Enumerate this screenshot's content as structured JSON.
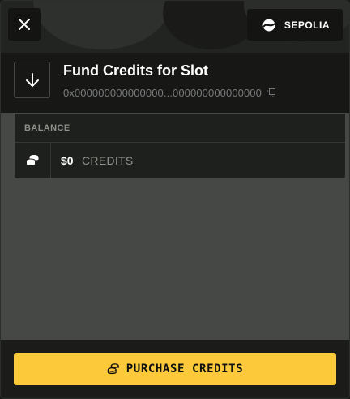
{
  "network": {
    "label": "SEPOLIA",
    "icon": "network-globe-icon"
  },
  "header": {
    "title": "Fund Credits for Slot",
    "address": "0x000000000000000...000000000000000",
    "icon": "arrow-down-icon"
  },
  "balance": {
    "label": "BALANCE",
    "amount": "$0",
    "unit": "CREDITS",
    "icon": "coins-icon"
  },
  "footer": {
    "purchase_label": "PURCHASE CREDITS",
    "icon": "coins-icon"
  },
  "colors": {
    "accent": "#fcc93b",
    "background": "#454845",
    "panel": "#171816"
  }
}
